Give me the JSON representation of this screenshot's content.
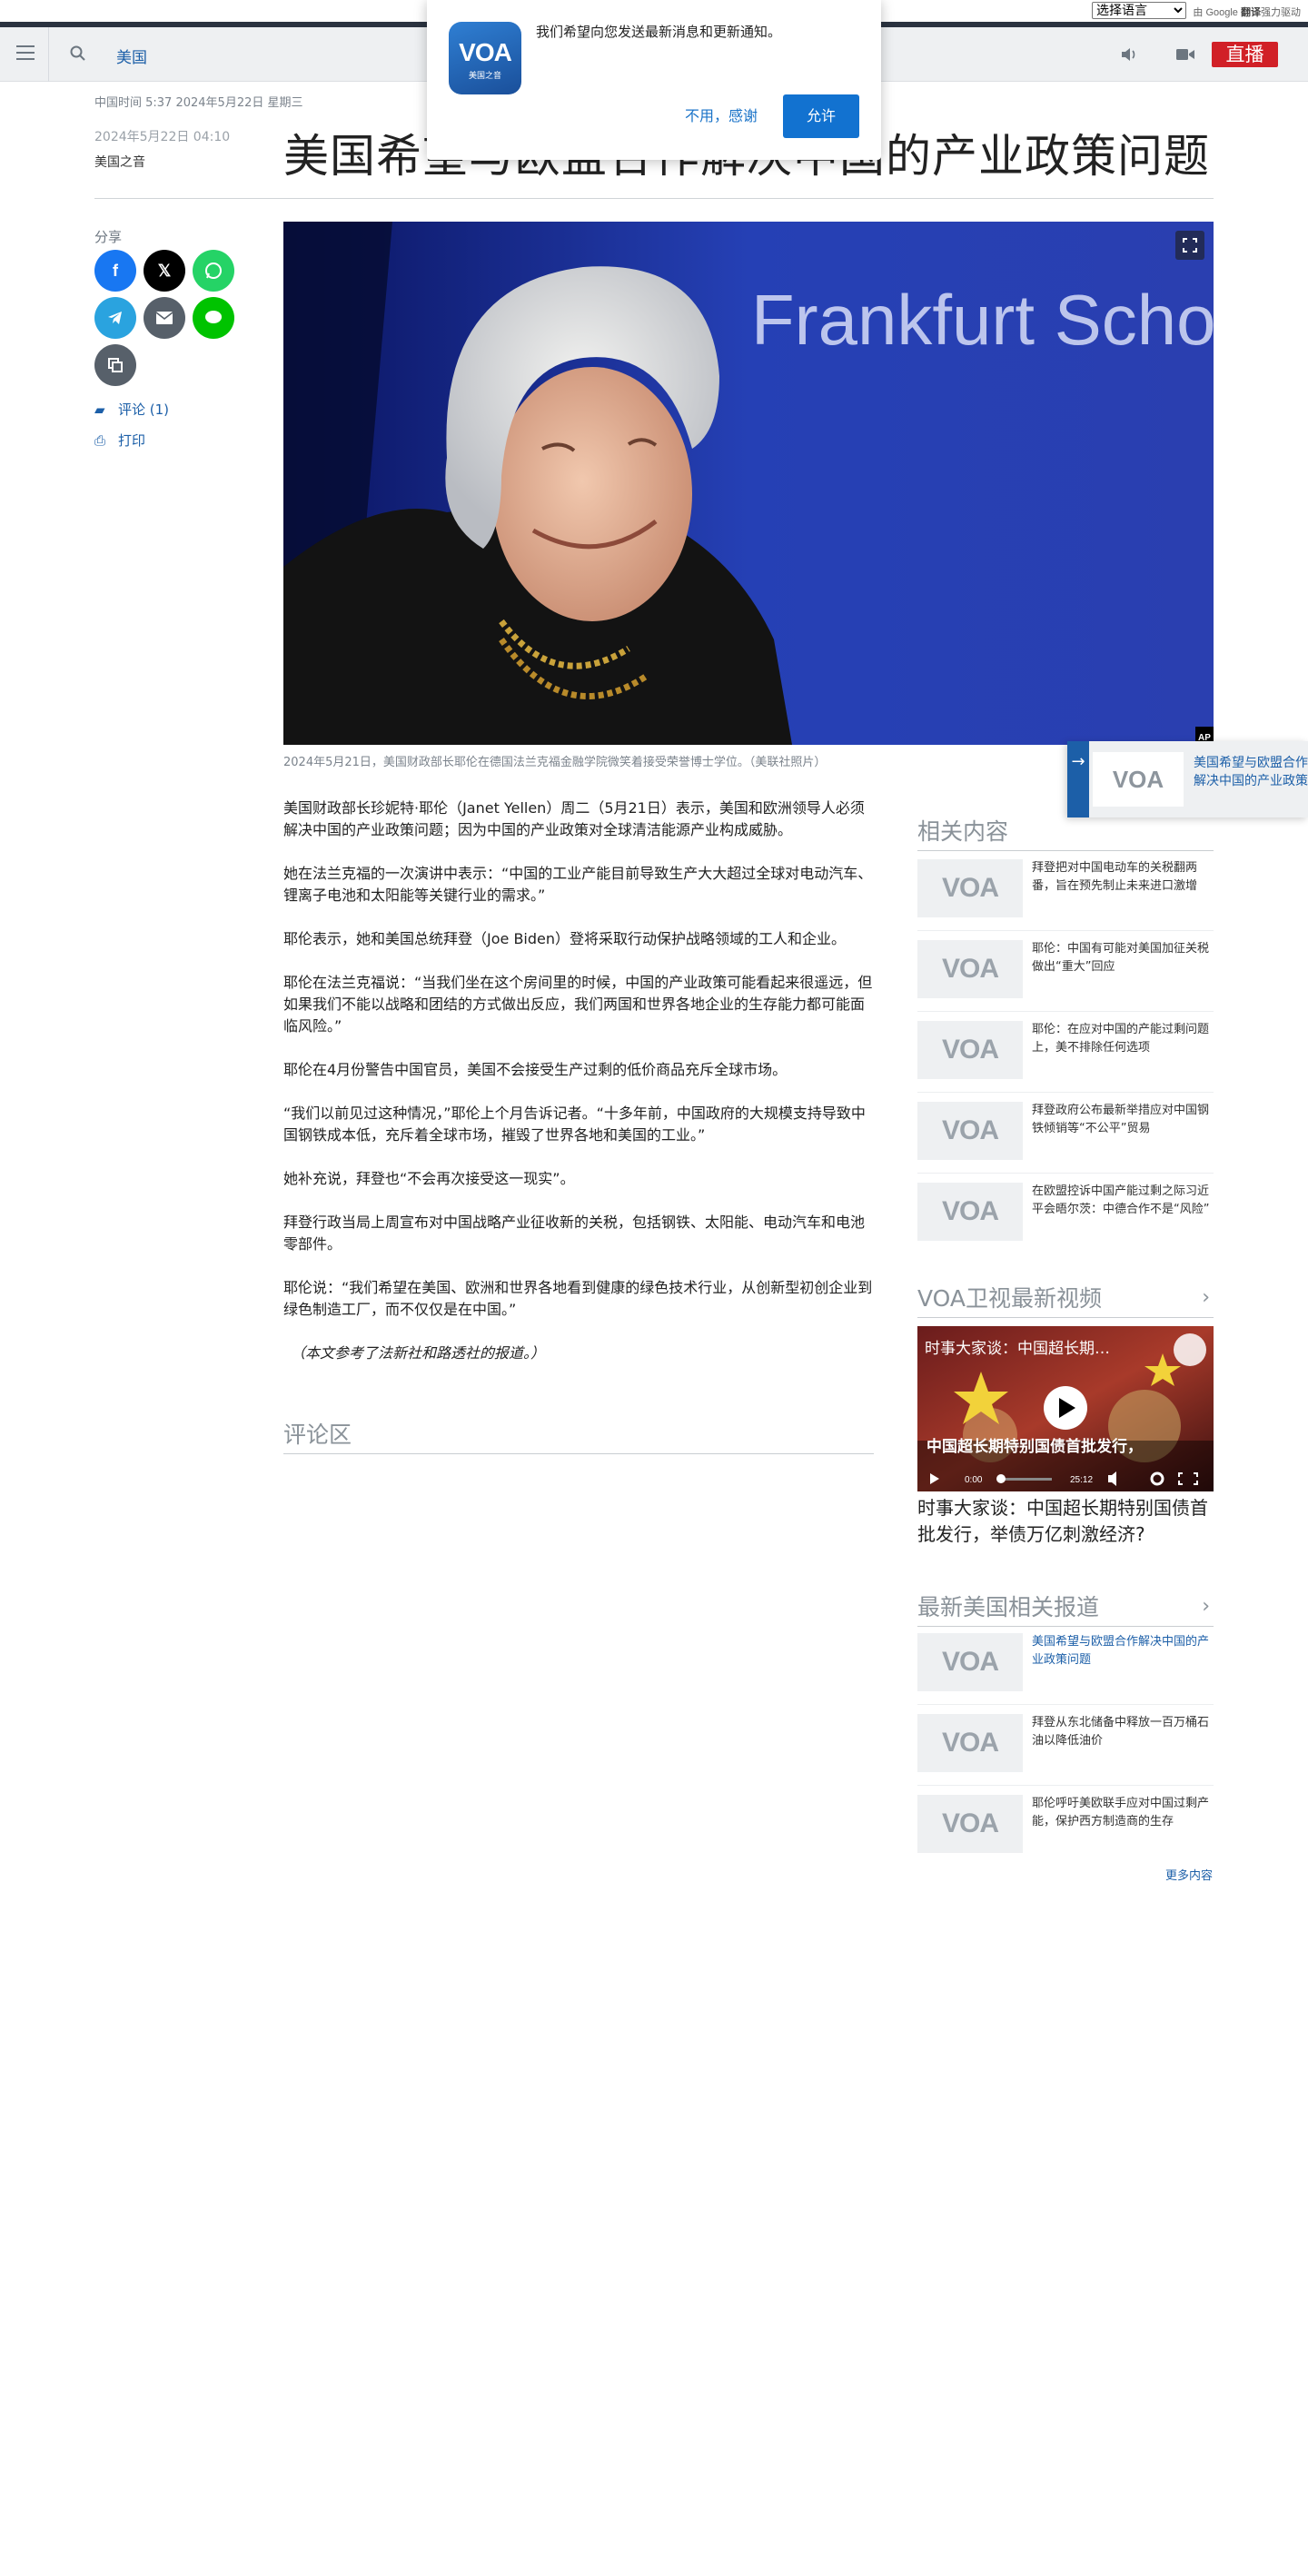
{
  "translate": {
    "select_label": "选择语言",
    "powered_prefix": "由",
    "powered_brand": "Google",
    "powered_word": "翻译",
    "powered_suffix": "强力驱动"
  },
  "header": {
    "nav_item": "美国",
    "live_label": "直播"
  },
  "notification": {
    "logo_text": "VOA",
    "logo_sub": "美国之音",
    "message": "我们希望向您发送最新消息和更新通知。",
    "decline_label": "不用，感谢",
    "accept_label": "允许"
  },
  "article": {
    "dateline": "中国时间 5:37 2024年5月22日 星期三",
    "published": "2024年5月22日 04:10",
    "author": "美国之音",
    "headline": "美国希望与欧盟合作解决中国的产业政策问题",
    "image_sign_text": "Frankfurt School",
    "image_credit": "AP",
    "caption": "2024年5月21日，美国财政部长耶伦在德国法兰克福金融学院微笑着接受荣誉博士学位。（美联社照片）",
    "paragraphs": [
      "美国财政部长珍妮特·耶伦（Janet Yellen）周二（5月21日）表示，美国和欧洲领导人必须解决中国的产业政策问题；因为中国的产业政策对全球清洁能源产业构成威胁。",
      "她在法兰克福的一次演讲中表示：“中国的工业产能目前导致生产大大超过全球对电动汽车、锂离子电池和太阳能等关键行业的需求。”",
      "耶伦表示，她和美国总统拜登（Joe Biden）登将采取行动保护战略领域的工人和企业。",
      "耶伦在法兰克福说：“当我们坐在这个房间里的时候，中国的产业政策可能看起来很遥远，但如果我们不能以战略和团结的方式做出反应，我们两国和世界各地企业的生存能力都可能面临风险。”",
      "耶伦在4月份警告中国官员，美国不会接受生产过剩的低价商品充斥全球市场。",
      "“我们以前见过这种情况，”耶伦上个月告诉记者。“十多年前，中国政府的大规模支持导致中国钢铁成本低，充斥着全球市场，摧毁了世界各地和美国的工业。”",
      "她补充说，拜登也“不会再次接受这一现实”。",
      "拜登行政当局上周宣布对中国战略产业征收新的关税，包括钢铁、太阳能、电动汽车和电池零部件。",
      "耶伦说：“我们希望在美国、欧洲和世界各地看到健康的绿色技术行业，从创新型初创企业到绿色制造工厂，而不仅仅是在中国。”"
    ],
    "note": "（本文参考了法新社和路透社的报道。）",
    "comments_heading": "评论区"
  },
  "share": {
    "label": "分享",
    "comments_link": "评论 (1)",
    "print_link": "打印",
    "colors": {
      "facebook": "#1877f2",
      "x": "#000000",
      "whatsapp": "#25d366",
      "telegram": "#2aa3df",
      "email": "#57606a",
      "line": "#00c300",
      "copy": "#57606a"
    }
  },
  "sidebar": {
    "related_heading": "相关内容",
    "related": [
      "拜登把对中国电动车的关税翻两番，旨在预先制止未来进口激增",
      "耶伦：中国有可能对美国加征关税做出“重大”回应",
      "耶伦：在应对中国的产能过剩问题上，美不排除任何选项",
      "拜登政府公布最新举措应对中国钢铁倾销等“不公平”贸易",
      "在欧盟控诉中国产能过剩之际习近平会晤尔茨：中德合作不是“风险”"
    ],
    "video_heading": "VOA卫视最新视频",
    "video": {
      "overlay_title": "时事大家谈：中国超长期…",
      "banner_text": "中国超长期特别国债首批发行，",
      "time_current": "0:00",
      "time_total": "25:12",
      "title": "时事大家谈：中国超长期特别国债首批发行，举债万亿刺激经济?"
    },
    "latest_heading": "最新美国相关报道",
    "latest": [
      "美国希望与欧盟合作解决中国的产业政策问题",
      "拜登从东北储备中释放一百万桶石油以降低油价",
      "耶伦呼吁美欧联手应对中国过剩产能，保护西方制造商的生存"
    ],
    "more_link": "更多内容"
  },
  "floating_player": {
    "thumb_text": "VOA",
    "title": "美国希望与欧盟合作解决中国的产业政策问题"
  }
}
